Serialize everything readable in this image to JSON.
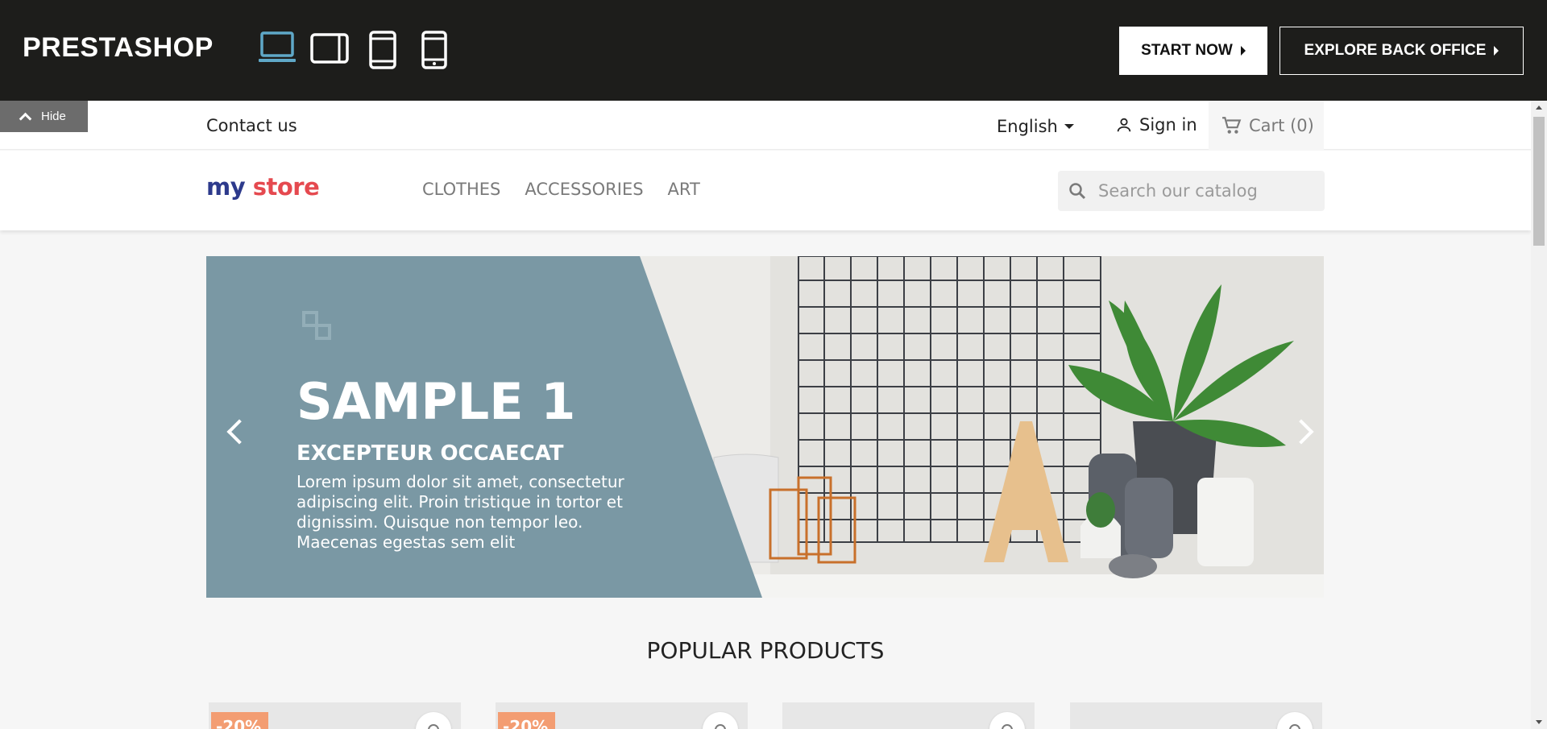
{
  "demo_bar": {
    "logo": "PRESTASHOP",
    "devices": [
      "desktop-icon",
      "tablet-landscape-icon",
      "tablet-portrait-icon",
      "mobile-icon"
    ],
    "active_device": "desktop",
    "start_label": "START NOW",
    "explore_label": "EXPLORE BACK OFFICE"
  },
  "hide_tab": {
    "label": "Hide"
  },
  "store": {
    "nav": {
      "contact": "Contact us",
      "language": "English",
      "signin": "Sign in",
      "cart": "Cart (0)"
    },
    "brand": {
      "word1": "my",
      "word2": "store"
    },
    "menu": [
      "CLOTHES",
      "ACCESSORIES",
      "ART"
    ],
    "search": {
      "placeholder": "Search our catalog"
    },
    "slider": {
      "title": "SAMPLE 1",
      "subtitle": "EXCEPTEUR OCCAECAT",
      "description": "Lorem ipsum dolor sit amet, consectetur adipiscing elit. Proin tristique in tortor et dignissim. Quisque non tempor leo. Maecenas egestas sem elit",
      "panel_color": "#7a98a4"
    },
    "section_title": "POPULAR PRODUCTS",
    "products": [
      {
        "badge": "-20%"
      },
      {
        "badge": "-20%"
      },
      {
        "badge": ""
      },
      {
        "badge": ""
      }
    ]
  },
  "colors": {
    "demo_bar_bg": "#1d1d1b",
    "active_device": "#5fa8c8",
    "badge": "#f39d72"
  }
}
